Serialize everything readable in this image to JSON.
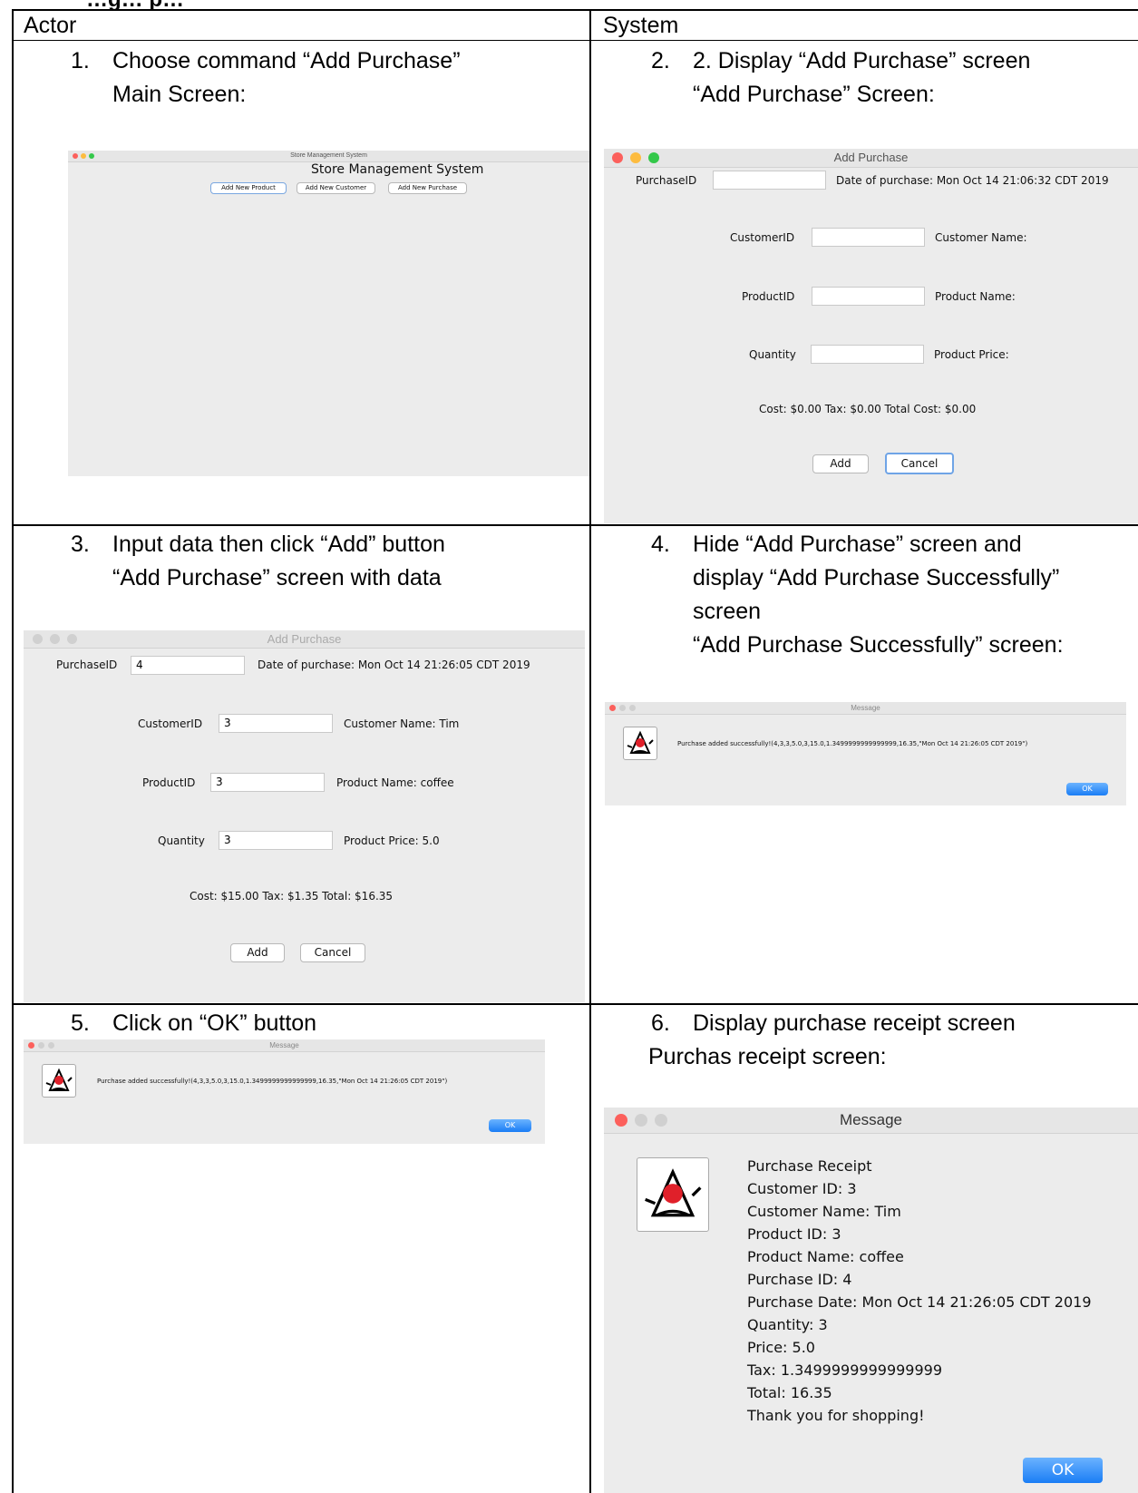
{
  "partial_header": "…g… p…",
  "columns": {
    "actor": "Actor",
    "system": "System"
  },
  "steps": [
    {
      "num": "1.",
      "lines": [
        "Choose command “Add Purchase”",
        "Main Screen:"
      ]
    },
    {
      "num": "2.",
      "lines": [
        "2. Display “Add Purchase” screen",
        "“Add Purchase” Screen:"
      ]
    },
    {
      "num": "3.",
      "lines": [
        "Input data then click “Add” button",
        "“Add Purchase” screen with data"
      ]
    },
    {
      "num": "4.",
      "lines": [
        "Hide “Add Purchase” screen and",
        "display “Add Purchase Successfully”",
        "screen",
        "“Add Purchase Successfully” screen:"
      ]
    },
    {
      "num": "5.",
      "lines": [
        "Click on “OK” button"
      ]
    },
    {
      "num": "6.",
      "lines": [
        "Display purchase receipt screen",
        "Purchas receipt screen:"
      ]
    }
  ],
  "main_screen": {
    "window_title": "Store Management System",
    "heading": "Store Management System",
    "buttons": [
      "Add New Product",
      "Add New Customer",
      "Add New Purchase"
    ]
  },
  "add_purchase_empty": {
    "window_title": "Add Purchase",
    "purchase_id_label": "PurchaseID",
    "purchase_id_value": "",
    "date_text": "Date of purchase: Mon Oct 14 21:06:32 CDT 2019",
    "customer_id_label": "CustomerID",
    "customer_name": "Customer Name:",
    "product_id_label": "ProductID",
    "product_name": "Product Name:",
    "quantity_label": "Quantity",
    "product_price": "Product Price:",
    "cost_line": "Cost: $0.00  Tax: $0.00 Total Cost: $0.00",
    "add_label": "Add",
    "cancel_label": "Cancel"
  },
  "add_purchase_filled": {
    "window_title": "Add Purchase",
    "purchase_id_label": "PurchaseID",
    "purchase_id_value": "4",
    "date_text": "Date of purchase: Mon Oct 14 21:26:05 CDT 2019",
    "customer_id_label": "CustomerID",
    "customer_id_value": "3",
    "customer_name": "Customer Name: Tim",
    "product_id_label": "ProductID",
    "product_id_value": "3",
    "product_name": "Product Name: coffee",
    "quantity_label": "Quantity",
    "quantity_value": "3",
    "product_price": "Product Price: 5.0",
    "cost_line": "Cost: $15.00 Tax: $1.35 Total: $16.35",
    "add_label": "Add",
    "cancel_label": "Cancel"
  },
  "success_message": {
    "window_title": "Message",
    "text": "Purchase added successfully!(4,3,3,5.0,3,15.0,1.3499999999999999,16.35,\"Mon Oct 14 21:26:05 CDT 2019\")",
    "ok_label": "OK"
  },
  "receipt": {
    "window_title": "Message",
    "lines": [
      "Purchase Receipt",
      "Customer ID: 3",
      "Customer Name: Tim",
      "Product ID: 3",
      "Product Name: coffee",
      "Purchase ID: 4",
      "Purchase Date: Mon Oct 14 21:26:05 CDT 2019",
      "Quantity: 3",
      "Price: 5.0",
      "Tax: 1.3499999999999999",
      "Total: 16.35",
      "Thank you for shopping!"
    ],
    "ok_label": "OK"
  },
  "colors": {
    "close": "#fc605c",
    "minimize": "#fdbc40",
    "zoom": "#34c84a",
    "inactive": "#d0d0d0",
    "ok_blue": "#1a7df5"
  }
}
